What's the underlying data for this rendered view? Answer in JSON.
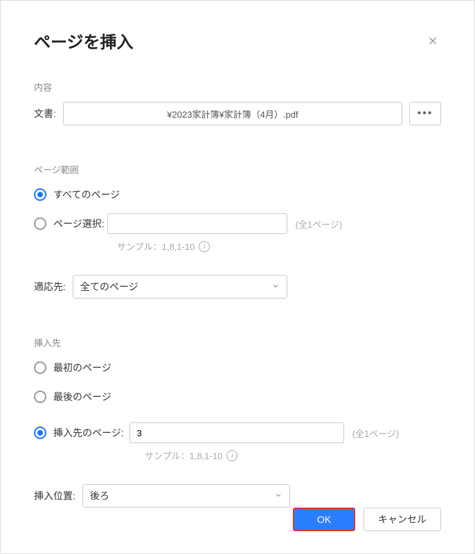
{
  "dialog": {
    "title": "ページを挿入"
  },
  "content": {
    "section_label": "内容",
    "document_label": "文書:",
    "document_value": "¥2023家計簿¥家計簿（4月）.pdf"
  },
  "range": {
    "section_label": "ページ範囲",
    "all_pages_label": "すべてのページ",
    "select_pages_label": "ページ選択:",
    "total_pages_hint": "(全1ページ)",
    "sample_hint": "サンプル：1,8,1-10",
    "adapt_label": "適応先:",
    "adapt_value": "全てのページ"
  },
  "insert": {
    "section_label": "挿入先",
    "first_page_label": "最初のページ",
    "last_page_label": "最後のページ",
    "target_page_label": "挿入先のページ:",
    "target_page_value": "3",
    "total_pages_hint": "(全1ページ)",
    "sample_hint": "サンプル：1,8,1-10",
    "position_label": "挿入位置:",
    "position_value": "後ろ"
  },
  "footer": {
    "ok_label": "OK",
    "cancel_label": "キャンセル"
  }
}
